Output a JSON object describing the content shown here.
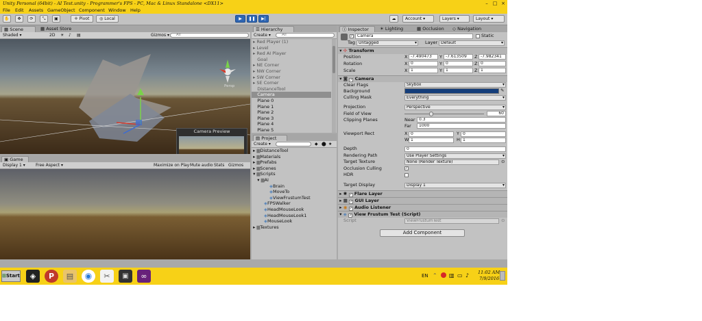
{
  "window": {
    "title": "Unity Personal (64bit) - AI Test.unity - Programmer's FPS - PC, Mac & Linux Standalone <DX11>"
  },
  "menu": [
    "File",
    "Edit",
    "Assets",
    "GameObject",
    "Component",
    "Window",
    "Help"
  ],
  "toolbar": {
    "pivot": "Pivot",
    "local": "Local",
    "account": "Account",
    "layers": "Layers",
    "layout": "Layout"
  },
  "scene": {
    "tab_scene": "Scene",
    "tab_asset_store": "Asset Store",
    "shaded": "Shaded",
    "mode_2d": "2D",
    "gizmos": "Gizmos",
    "search": "All",
    "persp": "Persp",
    "preview_title": "Camera Preview"
  },
  "game": {
    "tab": "Game",
    "display": "Display 1",
    "aspect": "Free Aspect",
    "max_on_play": "Maximize on Play",
    "mute": "Mute audio",
    "stats": "Stats",
    "gizmos": "Gizmos"
  },
  "hierarchy": {
    "tab": "Hierarchy",
    "create": "Create",
    "search": "All",
    "items": [
      "Red Player (1)",
      "Level",
      "Red AI Player",
      "Goal",
      "NE Corner",
      "NW Corner",
      "SW Corner",
      "SE Corner",
      "DistanceTool",
      "Camera",
      "Plane 0",
      "Plane 1",
      "Plane 2",
      "Plane 3",
      "Plane 4",
      "Plane 5"
    ]
  },
  "project": {
    "tab": "Project",
    "create": "Create",
    "items": [
      "DistanceTool",
      "Materials",
      "Prefabs",
      "Scenes",
      "Scripts",
      "AI",
      "Brain",
      "MoveTo",
      "ViewFrustumTest",
      "FPSWalker",
      "HeadMouseLook",
      "HeadMouseLook1",
      "MouseLook",
      "Textures"
    ]
  },
  "inspector": {
    "tabs": [
      "Inspector",
      "Lighting",
      "Occlusion",
      "Navigation"
    ],
    "object_name": "Camera",
    "static": "Static",
    "tag_label": "Tag",
    "tag": "Untagged",
    "layer_label": "Layer",
    "layer": "Default",
    "transform": {
      "title": "Transform",
      "position_label": "Position",
      "rotation_label": "Rotation",
      "scale_label": "Scale",
      "pos_x": "-7.490473",
      "pos_y": "-7.613509",
      "pos_z": "-7.982341",
      "rot_x": "0",
      "rot_y": "0",
      "rot_z": "0",
      "scl_x": "1",
      "scl_y": "1",
      "scl_z": "1",
      "x": "X",
      "y": "Y",
      "z": "Z"
    },
    "camera": {
      "title": "Camera",
      "clear_flags_label": "Clear Flags",
      "clear_flags": "Skybox",
      "background_label": "Background",
      "culling_mask_label": "Culling Mask",
      "culling_mask": "Everything",
      "projection_label": "Projection",
      "projection": "Perspective",
      "fov_label": "Field of View",
      "fov": "60",
      "clipping_label": "Clipping Planes",
      "near_label": "Near",
      "near": "0.3",
      "far_label": "Far",
      "far": "1000",
      "viewport_label": "Viewport Rect",
      "vp_x": "0",
      "vp_y": "0",
      "vp_w": "1",
      "vp_h": "1",
      "w": "W",
      "h": "H",
      "depth_label": "Depth",
      "depth": "0",
      "rendering_path_label": "Rendering Path",
      "rendering_path": "Use Player Settings",
      "target_texture_label": "Target Texture",
      "target_texture": "None (Render Texture)",
      "occlusion_label": "Occlusion Culling",
      "hdr_label": "HDR",
      "target_display_label": "Target Display",
      "target_display": "Display 1"
    },
    "components": [
      "Flare Layer",
      "GUI Layer",
      "Audio Listener",
      "View Frustum Test (Script)"
    ],
    "script_label": "Script",
    "script": "ViewFrustumTest",
    "add_component": "Add Component"
  },
  "taskbar": {
    "start": "Start",
    "lang": "EN",
    "time": "11:02 AM",
    "date": "7/9/2016"
  }
}
